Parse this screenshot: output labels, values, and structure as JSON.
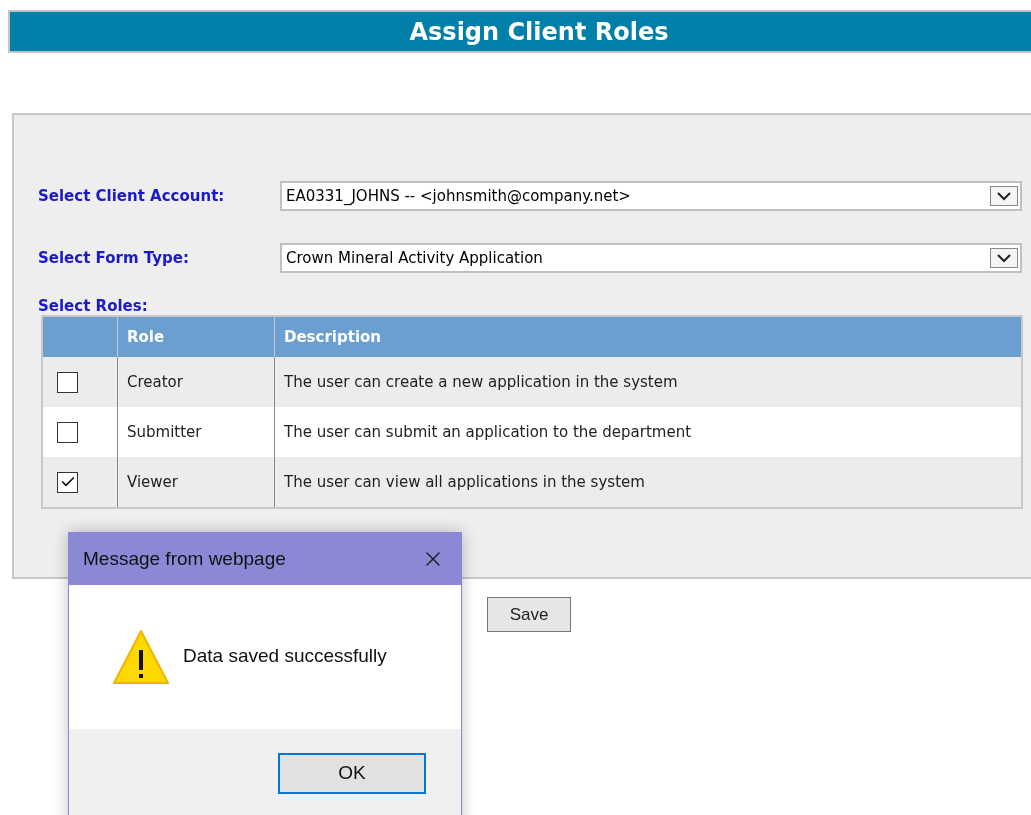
{
  "title": "Assign Client Roles",
  "fields": [
    {
      "label": "Select Client Account:",
      "value": "EA0331_JOHNS -- <johnsmith@company.net>"
    },
    {
      "label": "Select Form Type:",
      "value": "Crown Mineral Activity Application"
    }
  ],
  "roles_label": "Select Roles:",
  "table": {
    "columns": [
      "Role",
      "Description"
    ],
    "rows": [
      {
        "checked": false,
        "role": "Creator",
        "description": "The user can create a new application in the system"
      },
      {
        "checked": false,
        "role": "Submitter",
        "description": "The user can submit an application to the department"
      },
      {
        "checked": true,
        "role": "Viewer",
        "description": "The user can view all applications in the system"
      }
    ]
  },
  "save_button": "Save",
  "dialog": {
    "title": "Message from webpage",
    "message": "Data saved successfully",
    "ok_button": "OK"
  }
}
